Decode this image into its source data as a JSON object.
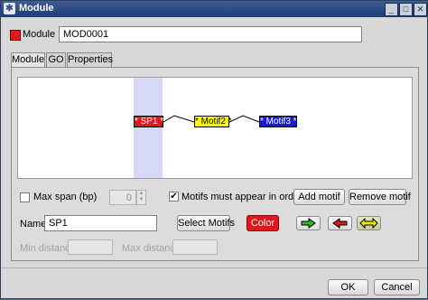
{
  "window": {
    "title": "Module"
  },
  "module_id": {
    "label": "Module ID",
    "value": "MOD0001",
    "color": "#e0171c"
  },
  "tabs": [
    {
      "label": "Module"
    },
    {
      "label": "GO"
    },
    {
      "label": "Properties"
    }
  ],
  "motifs": [
    {
      "label": "* SP1 *",
      "color": "#e0171c",
      "text_color": "#ffffff"
    },
    {
      "label": "* Motif2 *",
      "color": "#ffff00",
      "text_color": "#000000"
    },
    {
      "label": "* Motif3 *",
      "color": "#1a1ad0",
      "text_color": "#ffffff"
    }
  ],
  "highlight_color": "#d8d8f8",
  "controls": {
    "max_span_label": "Max span (bp)",
    "max_span_checked": false,
    "max_span_value": "0",
    "order_label": "Motifs must appear in order",
    "order_checked": true,
    "add_motif": "Add motif",
    "remove_motif": "Remove motif",
    "name_label": "Name",
    "name_value": "SP1",
    "select_motifs": "Select Motifs",
    "color_button": "Color",
    "color_button_color": "#e0171c",
    "min_distance_label": "Min distance",
    "max_distance_label": "Max distance",
    "arrow_colors": {
      "right": "#22c022",
      "left": "#e0171c",
      "both": "#e8e800"
    }
  },
  "footer": {
    "ok": "OK",
    "cancel": "Cancel"
  }
}
